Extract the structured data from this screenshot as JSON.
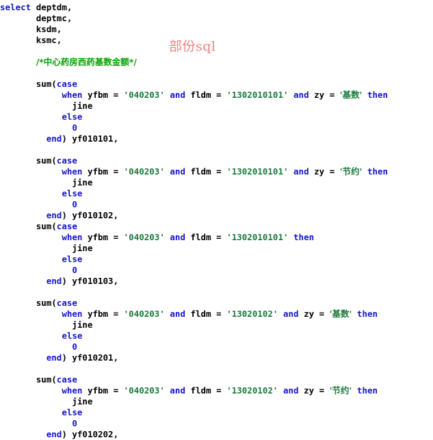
{
  "document": {
    "kind": "sql-source-snippet",
    "background_color": "#ffffff",
    "language": "sql"
  },
  "watermark": {
    "text": "部份sql",
    "color": "#f08080"
  },
  "theme": {
    "keyword_color": "#1414cc",
    "string_color": "#1a7a3c",
    "comment_color": "#00a000",
    "identifier_color": "#000000",
    "number_color": "#1414cc",
    "background_color": "#ffffff"
  },
  "code": {
    "select_keyword": "select",
    "select_columns": [
      "deptdm,",
      "deptmc,",
      "ksdm,",
      "ksmc,"
    ],
    "comment": "/*中心药房西药基数金额*/",
    "tokens": {
      "sum_open": "sum(",
      "case": "case",
      "when": "when",
      "and": "and",
      "then": "then",
      "else": "else",
      "end": "end",
      "eq": "=",
      "yfbm": "yfbm",
      "fldm": "fldm",
      "zy": "zy",
      "jine": "jine",
      "zero": "0",
      "close_paren": ")"
    },
    "blocks": [
      {
        "yfbm_value": "'040203'",
        "fldm_value": "'1302010101'",
        "zy_value": "'基数'",
        "has_zy": true,
        "then_value": "jine",
        "else_value": "0",
        "alias": "yf010101,",
        "blank_line_before": true
      },
      {
        "yfbm_value": "'040203'",
        "fldm_value": "'1302010101'",
        "zy_value": "'节约'",
        "has_zy": true,
        "then_value": "jine",
        "else_value": "0",
        "alias": "yf010102,",
        "blank_line_before": true
      },
      {
        "yfbm_value": "'040203'",
        "fldm_value": "'1302010101'",
        "zy_value": "",
        "has_zy": false,
        "then_value": "jine",
        "else_value": "0",
        "alias": "yf010103,",
        "blank_line_before": false
      },
      {
        "yfbm_value": "'040203'",
        "fldm_value": "'13020102'",
        "zy_value": "'基数'",
        "has_zy": true,
        "then_value": "jine",
        "else_value": "0",
        "alias": "yf010201,",
        "blank_line_before": true
      },
      {
        "yfbm_value": "'040203'",
        "fldm_value": "'13020102'",
        "zy_value": "'节约'",
        "has_zy": true,
        "then_value": "jine",
        "else_value": "0",
        "alias": "yf010202,",
        "blank_line_before": true
      }
    ]
  }
}
